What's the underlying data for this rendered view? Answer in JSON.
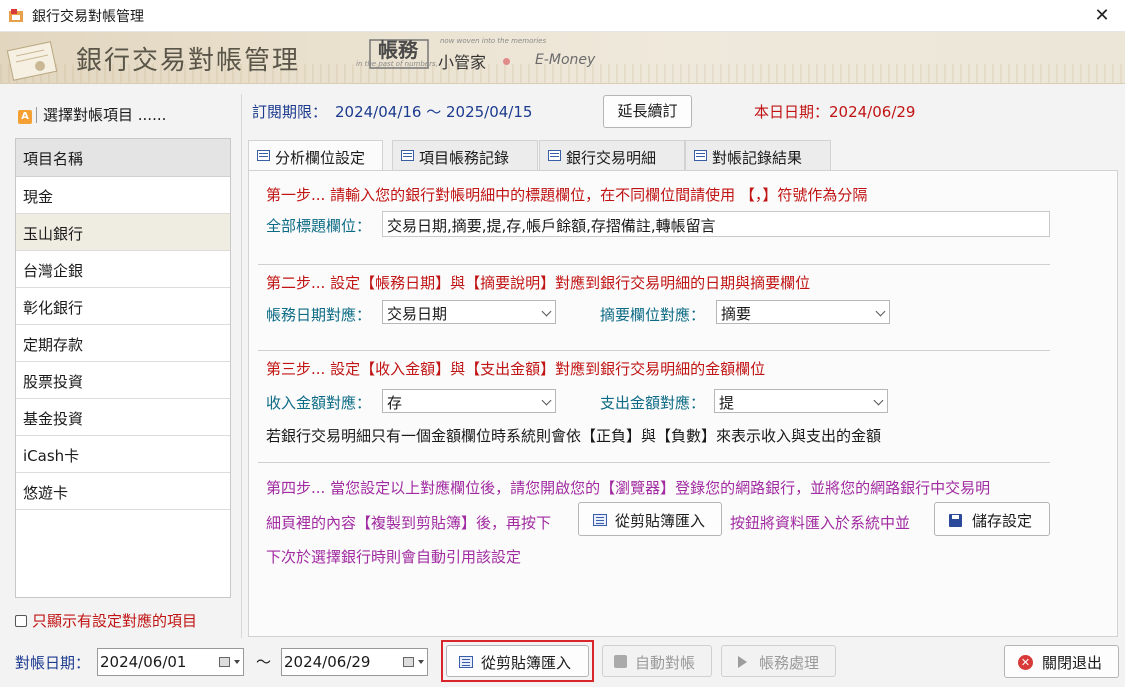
{
  "window": {
    "title": "銀行交易對帳管理",
    "close_glyph": "✕"
  },
  "banner": {
    "title": "銀行交易對帳管理",
    "logo_main": "帳務",
    "logo_sub": "小管家",
    "logo_en": "E-Money",
    "tagline1": "now woven into the memories",
    "tagline2": "in the past of numbers,"
  },
  "left": {
    "header": "選擇對帳項目 ......",
    "header_icon": "A",
    "column_header": "項目名稱",
    "items": [
      "現金",
      "玉山銀行",
      "台灣企銀",
      "彰化銀行",
      "定期存款",
      "股票投資",
      "基金投資",
      "iCash卡",
      "悠遊卡"
    ],
    "selected_index": 1,
    "only_show_label": "只顯示有設定對應的項目"
  },
  "info": {
    "subscription_label": "訂閱期限：",
    "subscription_range": "2024/04/16 ～ 2025/04/15",
    "extend_button": "延長續訂",
    "today_label": "本日日期：2024/06/29"
  },
  "tabs": [
    {
      "label": "分析欄位設定",
      "active": true
    },
    {
      "label": "項目帳務記錄",
      "active": false
    },
    {
      "label": "銀行交易明細",
      "active": false
    },
    {
      "label": "對帳記錄結果",
      "active": false
    }
  ],
  "step1": {
    "title": "第一步... 請輸入您的銀行對帳明細中的標題欄位，在不同欄位間請使用 【，】符號作為分隔",
    "field_label": "全部標題欄位：",
    "field_value": "交易日期,摘要,提,存,帳戶餘額,存摺備註,轉帳留言"
  },
  "step2": {
    "title": "第二步... 設定【帳務日期】與【摘要說明】對應到銀行交易明細的日期與摘要欄位",
    "date_label": "帳務日期對應：",
    "date_value": "交易日期",
    "summary_label": "摘要欄位對應：",
    "summary_value": "摘要"
  },
  "step3": {
    "title": "第三步... 設定【收入金額】與【支出金額】對應到銀行交易明細的金額欄位",
    "income_label": "收入金額對應：",
    "income_value": "存",
    "expense_label": "支出金額對應：",
    "expense_value": "提",
    "note": "若銀行交易明細只有一個金額欄位時系統則會依【正負】與【負數】來表示收入與支出的金額"
  },
  "step4": {
    "line1": "第四步... 當您設定以上對應欄位後，請您開啟您的【瀏覽器】登錄您的網路銀行，並將您的網路銀行中交易明",
    "line2a": "細頁裡的內容【複製到剪貼簿】後，再按下",
    "import_button": "從剪貼簿匯入",
    "line2b": "按鈕將資料匯入於系統中並",
    "save_button": "儲存設定",
    "line3": "下次於選擇銀行時則會自動引用該設定"
  },
  "bottom": {
    "date_label": "對帳日期：",
    "date_from": "2024/06/01",
    "tilde": "～",
    "date_to": "2024/06/29",
    "import_button": "從剪貼簿匯入",
    "auto_button": "自動對帳",
    "process_button": "帳務處理",
    "exit_button": "關閉退出",
    "exit_glyph": "✕"
  },
  "colors": {
    "accent_blue": "#1c3b8f",
    "step_red": "#c11414",
    "teal": "#0d6b86",
    "purple": "#a12ba1",
    "highlight": "#d9262a"
  }
}
